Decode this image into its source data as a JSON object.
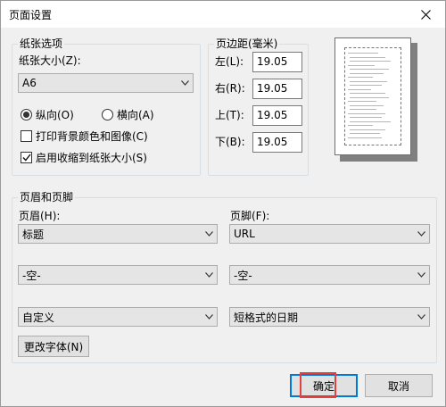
{
  "window": {
    "title": "页面设置",
    "close_icon": "close-icon"
  },
  "paper_options": {
    "group_label": "纸张选项",
    "size_label": "纸张大小(Z):",
    "size_value": "A6",
    "orientation_portrait": "纵向(O)",
    "orientation_landscape": "横向(A)",
    "orientation_selected": "portrait",
    "print_background_label": "打印背景颜色和图像(C)",
    "print_background_checked": false,
    "shrink_to_fit_label": "启用收缩到纸张大小(S)",
    "shrink_to_fit_checked": true
  },
  "margins": {
    "group_label": "页边距(毫米)",
    "left_label": "左(L):",
    "left_value": "19.05",
    "right_label": "右(R):",
    "right_value": "19.05",
    "top_label": "上(T):",
    "top_value": "19.05",
    "bottom_label": "下(B):",
    "bottom_value": "19.05"
  },
  "header_footer": {
    "group_label": "页眉和页脚",
    "header_label": "页眉(H):",
    "footer_label": "页脚(F):",
    "header_row1": "标题",
    "header_row2": "-空-",
    "header_row3": "自定义",
    "footer_row1": "URL",
    "footer_row2": "-空-",
    "footer_row3": "短格式的日期",
    "change_font_button": "更改字体(N)"
  },
  "buttons": {
    "ok": "确定",
    "cancel": "取消"
  },
  "colors": {
    "dialog_bg": "#f0f0f0",
    "default_button_border": "#0078d7",
    "highlight": "#e2413f"
  }
}
